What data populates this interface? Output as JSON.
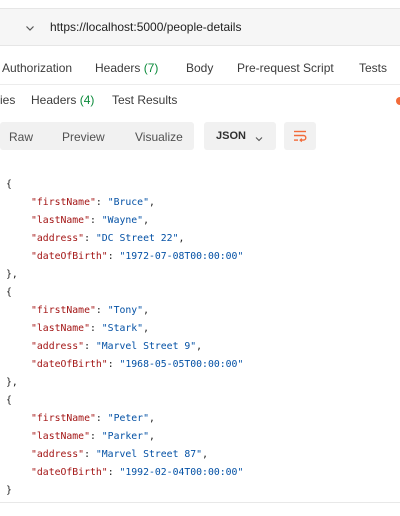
{
  "url_bar": {
    "url": "https://localhost:5000/people-details",
    "method_icon": "chevron-down-icon"
  },
  "request_tabs": [
    {
      "label": "Authorization"
    },
    {
      "label": "Headers",
      "count": "(7)"
    },
    {
      "label": "Body"
    },
    {
      "label": "Pre-request Script"
    },
    {
      "label": "Tests"
    }
  ],
  "response_tabs": [
    {
      "label": "ies"
    },
    {
      "label": "Headers",
      "count": "(4)"
    },
    {
      "label": "Test Results"
    }
  ],
  "view_toolbar": {
    "options": [
      "Raw",
      "Preview",
      "Visualize"
    ],
    "format": "JSON",
    "wrap_icon": "wrap-lines-icon"
  },
  "colors": {
    "key": "#a31515",
    "string": "#0451a5",
    "count": "#0a8a3a",
    "accent": "#f26b3a"
  },
  "response": [
    {
      "firstName": "Bruce",
      "lastName": "Wayne",
      "address": "DC Street 22",
      "dateOfBirth": "1972-07-08T00:00:00"
    },
    {
      "firstName": "Tony",
      "lastName": "Stark",
      "address": "Marvel Street 9",
      "dateOfBirth": "1968-05-05T00:00:00"
    },
    {
      "firstName": "Peter",
      "lastName": "Parker",
      "address": "Marvel Street 87",
      "dateOfBirth": "1992-02-04T00:00:00"
    }
  ]
}
